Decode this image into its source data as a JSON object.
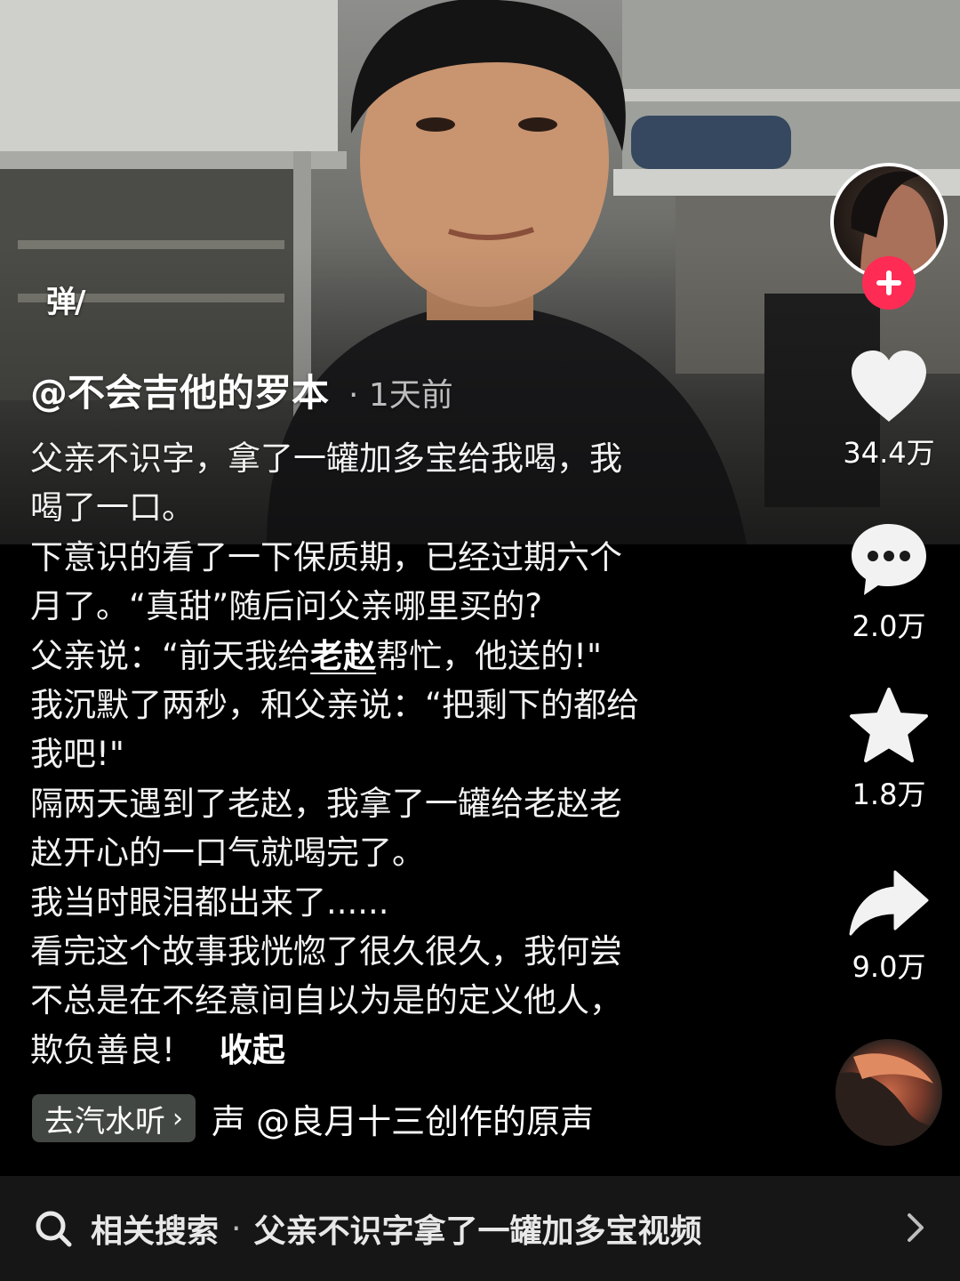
{
  "video": {
    "danmaku_label": "弹"
  },
  "author": {
    "handle": "@不会吉他的罗本",
    "time": "· 1天前"
  },
  "caption": {
    "lines": [
      "父亲不识字，拿了一罐加多宝给我喝，我",
      "喝了一口。",
      "下意识的看了一下保质期，已经过期六个",
      "月了。“真甜”随后问父亲哪里买的?",
      "我沉默了两秒，和父亲说：“把剩下的都给",
      "我吧!\"",
      "隔两天遇到了老赵，我拿了一罐给老赵老",
      "赵开心的一口气就喝完了。",
      "我当时眼泪都出来了......",
      "看完这个故事我恍惚了很久很久，我何尝",
      "不总是在不经意间自以为是的定义他人，"
    ],
    "line5_prefix": "父亲说：“前天我给",
    "line5_mention": "老赵",
    "line5_suffix": "帮忙，他送的!\"",
    "last_line": "欺负善良!",
    "collapse_label": "收起"
  },
  "music": {
    "chip_label": "去汽水听",
    "chip_chevron": "›",
    "scroll_text": "声    @良月十三创作的原声"
  },
  "actions": {
    "likes": "34.4万",
    "comments": "2.0万",
    "favorites": "1.8万",
    "shares": "9.0万"
  },
  "related_search": {
    "label": "相关搜索",
    "dot": "·",
    "query": "父亲不识字拿了一罐加多宝视频"
  },
  "colors": {
    "follow": "#fe2c55",
    "background": "#000000",
    "search_bar": "#161616"
  },
  "icons": [
    "danmaku-icon",
    "follow-plus-icon",
    "heart-icon",
    "comment-icon",
    "star-icon",
    "share-icon",
    "music-disc",
    "search-icon",
    "chevron-right-icon"
  ]
}
